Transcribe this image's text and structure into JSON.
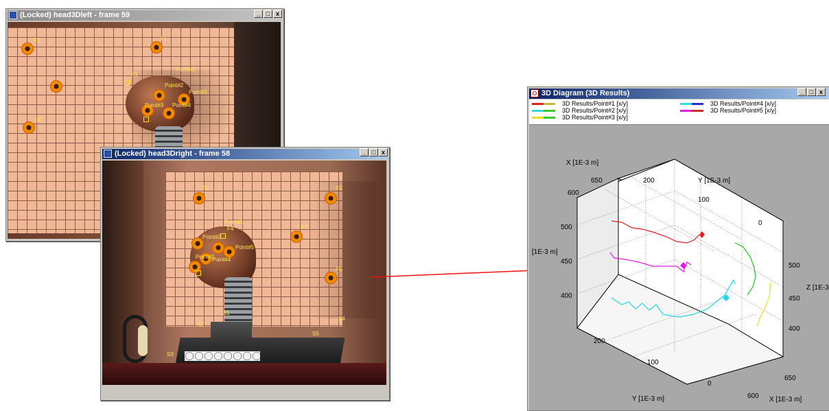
{
  "windows": {
    "left": {
      "title": "(Locked) head3Dleft - frame 59"
    },
    "right": {
      "title": "(Locked) head3Dright - frame 58"
    },
    "diagram": {
      "title": "3D Diagram (3D Results)"
    }
  },
  "window_buttons": {
    "minimize": "_",
    "maximize": "□",
    "close": "x"
  },
  "left_labels": {
    "f1": "F1",
    "f2": "F2",
    "f3": "F3",
    "f5": "F5",
    "p1": "Point#1",
    "p2": "Point#2",
    "p3": "Point#3",
    "p4": "Point#4",
    "p5": "Point#5"
  },
  "right_labels": {
    "f1": "F1",
    "f2": "F2",
    "f3": "F3",
    "f4": "F4",
    "f5": "F5",
    "p1": "Point#1",
    "p2": "Point#2",
    "p3": "Point#3",
    "p4": "Point#4",
    "p5": "Point#5",
    "s1": "S1",
    "s2": "S2",
    "s3": "S3",
    "s4": "S4",
    "s5": "S5"
  },
  "legend": [
    {
      "label": "3D Results/Point#1 [x/y]",
      "colors": [
        "#e02020",
        "#c8b43c"
      ]
    },
    {
      "label": "3D Results/Point#2 [x/y]",
      "colors": [
        "#38d8e0",
        "#38c838"
      ]
    },
    {
      "label": "3D Results/Point#3 [x/y]",
      "colors": [
        "#e8e020",
        "#38c838"
      ]
    },
    {
      "label": "3D Results/Point#4 [x/y]",
      "colors": [
        "#30e0e0",
        "#3030c0"
      ]
    },
    {
      "label": "3D Results/Point#5 [x/y]",
      "colors": [
        "#e020e0",
        "#c03030"
      ]
    }
  ],
  "axes": {
    "x_label_top": "X [1E-3 m]",
    "y_label_top": "Y [1E-3 m]",
    "left_label": "[1E-3 m]",
    "z_label": "Z [1E-3 m]",
    "y_label_bottom": "Y [1E-3 m]",
    "x_label_bottom": "X [1E-3 m]",
    "ticks_left": [
      "500",
      "450",
      "400"
    ],
    "ticks_right": [
      "500",
      "450",
      "400"
    ],
    "ticks_top_x": [
      "650",
      "600"
    ],
    "ticks_top_y": [
      "200",
      "100",
      "0"
    ],
    "ticks_bottom_y": [
      "200",
      "100",
      "0"
    ],
    "ticks_bottom_x": [
      "650",
      "600"
    ]
  },
  "colors": {
    "point1": "#e02020",
    "point2": "#20c820",
    "point3": "#e8e020",
    "point4": "#20d8e8",
    "point5": "#e020e0",
    "arrow": "#ee1111"
  }
}
